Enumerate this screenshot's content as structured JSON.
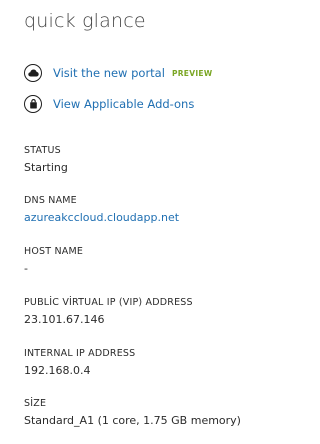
{
  "panel": {
    "title": "quick glance"
  },
  "links": [
    {
      "label": "Visit the new portal",
      "badge": "PREVIEW",
      "icon": "cloud-icon"
    },
    {
      "label": "View Applicable Add-ons",
      "icon": "shopping-bag-icon"
    }
  ],
  "fields": {
    "status": {
      "label": "STATUS",
      "value": "Starting"
    },
    "dns_name": {
      "label": "DNS NAME",
      "value": "azureakccloud.cloudapp.net"
    },
    "host_name": {
      "label": "HOST NAME",
      "value": "-"
    },
    "public_vip": {
      "label": "PUBLİC VİRTUAL IP (VIP) ADDRESS",
      "value": "23.101.67.146"
    },
    "internal_ip": {
      "label": "INTERNAL IP ADDRESS",
      "value": "192.168.0.4"
    },
    "size": {
      "label": "SİZE",
      "value": "Standard_A1 (1 core, 1.75 GB memory)"
    }
  },
  "colors": {
    "link": "#1f6fb2",
    "badge": "#7aa624",
    "text": "#2b2b2b"
  }
}
